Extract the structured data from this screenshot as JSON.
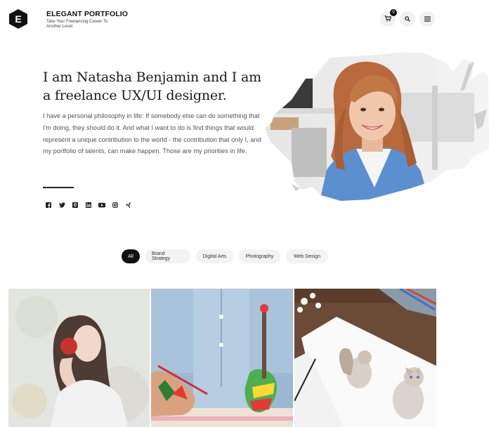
{
  "header": {
    "logo_letter": "E",
    "title": "ELEGANT PORTFOLIO",
    "tagline": "Take Your Freelancing Career To Another Level",
    "cart_count": "0",
    "icons": [
      "cart-icon",
      "search-icon",
      "menu-icon"
    ]
  },
  "hero": {
    "title": "I am Natasha Benjamin and I am a freelance UX/UI designer.",
    "text": "I have a personal philosophy in life: If somebody else can do something that I'm doing, they should do it. And what I want to do is find things that would represent a unique contribution to the world - the contribution that only I, and my portfolio of talents, can make happen. Those are my priorities in life."
  },
  "socials": [
    "facebook-icon",
    "twitter-icon",
    "pinterest-icon",
    "linkedin-icon",
    "youtube-icon",
    "instagram-icon",
    "xing-icon"
  ],
  "filters": [
    {
      "label": "All",
      "active": true
    },
    {
      "label": "Brand Strategy",
      "active": false
    },
    {
      "label": "Digital Arts",
      "active": false
    },
    {
      "label": "Photography",
      "active": false
    },
    {
      "label": "Web Design",
      "active": false
    }
  ],
  "colors": {
    "accent": "#111111",
    "text": "#555555",
    "pill_bg": "#f3f3f3"
  }
}
